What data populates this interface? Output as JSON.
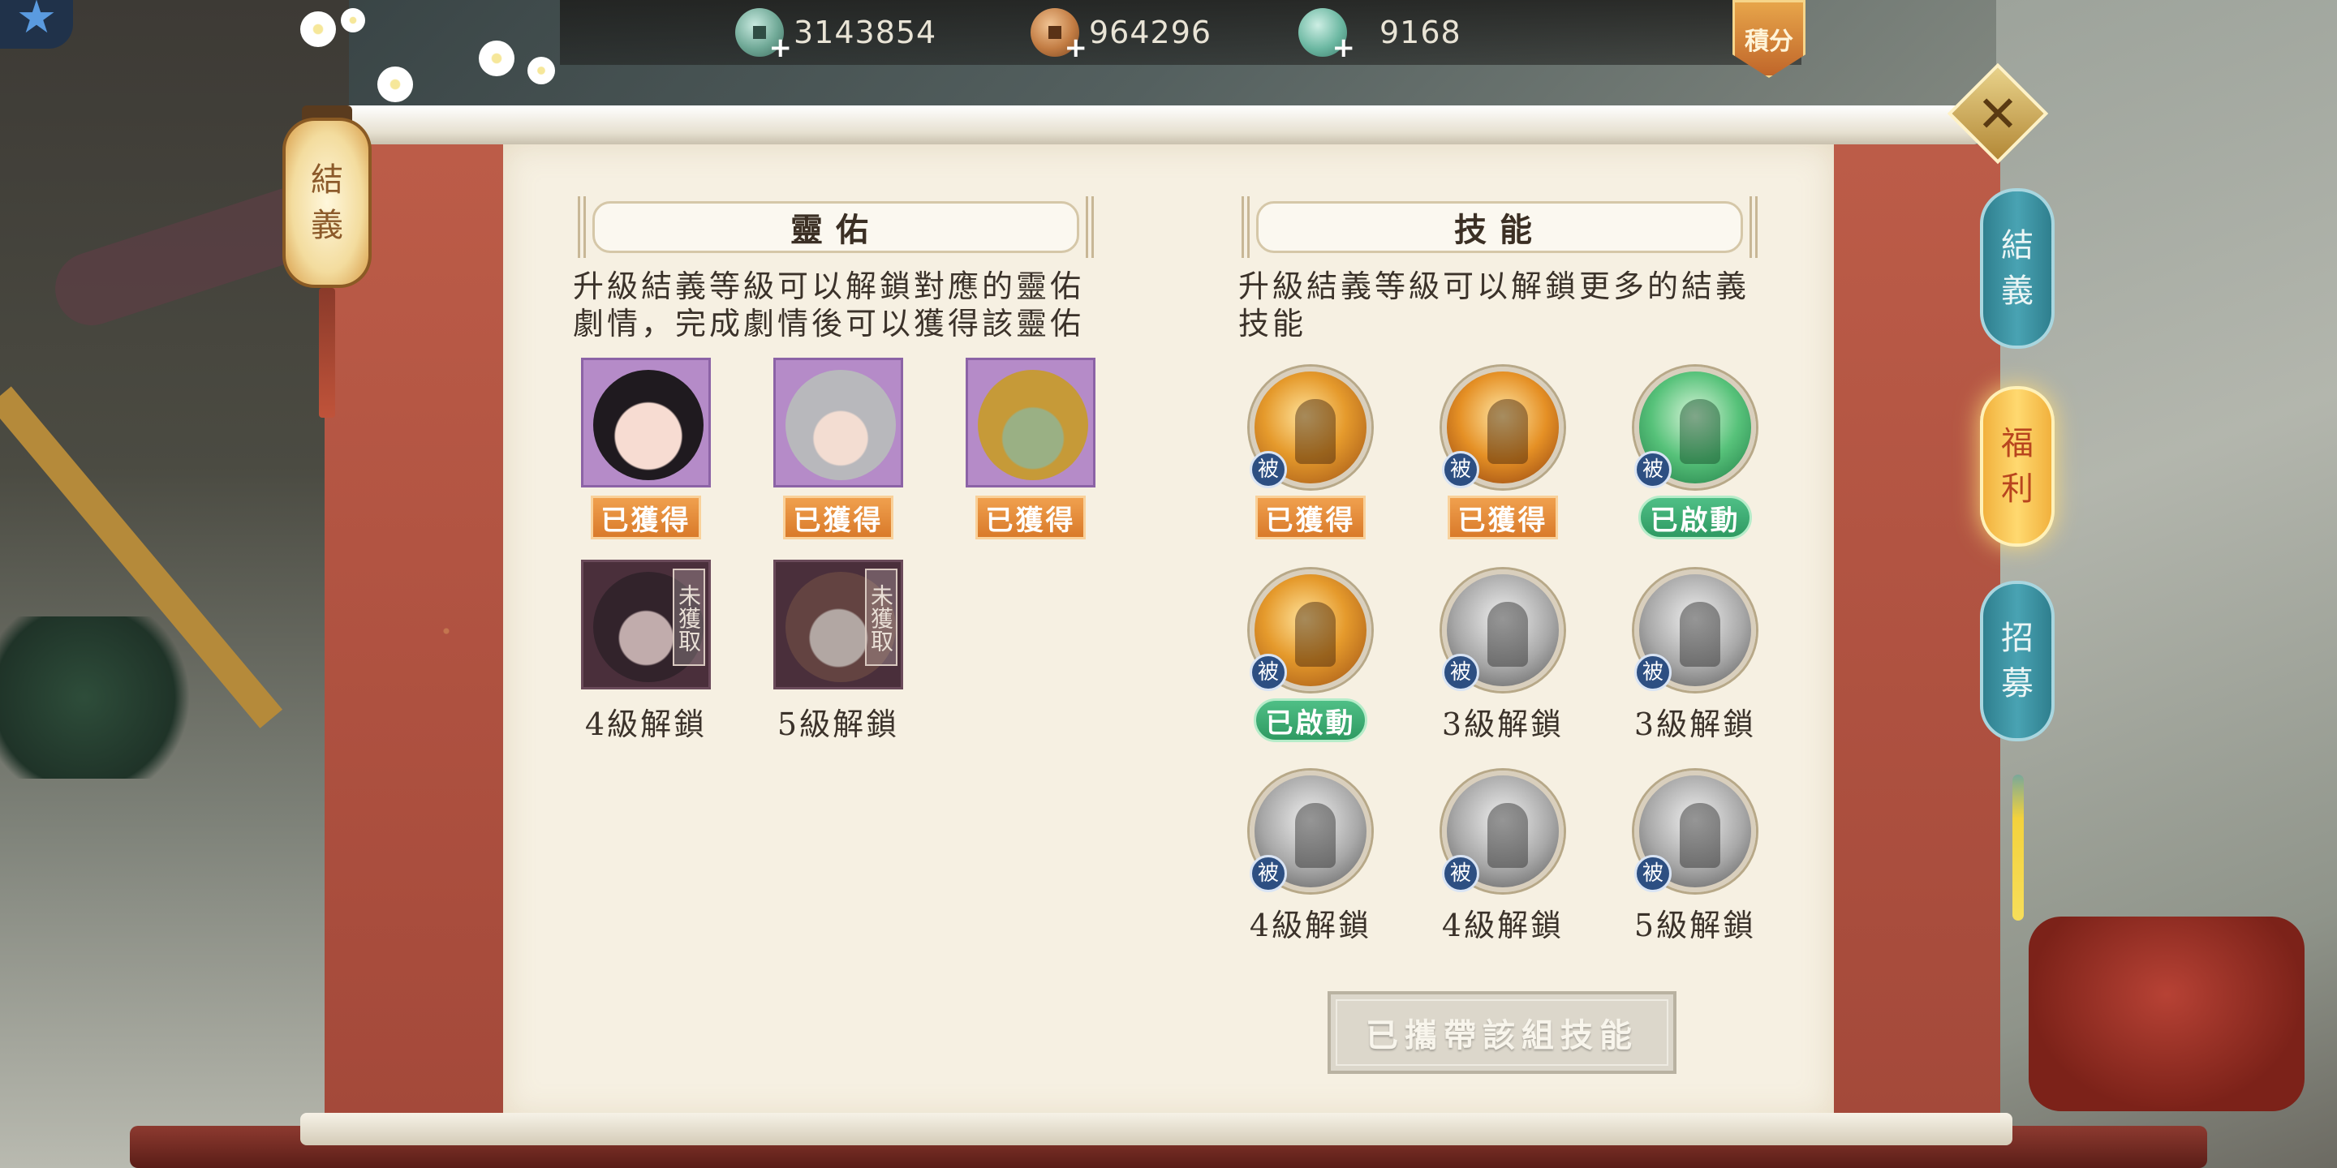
{
  "currencies": [
    {
      "icon": "jade-coin-icon",
      "value": "3143854"
    },
    {
      "icon": "copper-coin-icon",
      "value": "964296"
    },
    {
      "icon": "dragon-coin-icon",
      "value": "9168"
    }
  ],
  "points_badge": "積分",
  "lantern_label": [
    "結",
    "義"
  ],
  "spirit_section": {
    "title": "靈佑",
    "desc_lines": [
      "升級結義等級可以解鎖對應的靈佑",
      "劇情，完成劇情後可以獲得該靈佑"
    ],
    "items": [
      {
        "status": "已獲得"
      },
      {
        "status": "已獲得"
      },
      {
        "status": "已獲得"
      },
      {
        "lock_label": "未獲取",
        "status": "4級解鎖"
      },
      {
        "lock_label": "未獲取",
        "status": "5級解鎖"
      }
    ]
  },
  "skill_section": {
    "title": "技能",
    "desc_lines": [
      "升級結義等級可以解鎖更多的結義",
      "技能"
    ],
    "passive_label": "被",
    "items": [
      {
        "status": "已獲得"
      },
      {
        "status": "已獲得"
      },
      {
        "status": "已啟動"
      },
      {
        "status": "已啟動"
      },
      {
        "status": "3級解鎖"
      },
      {
        "status": "3級解鎖"
      },
      {
        "status": "4級解鎖"
      },
      {
        "status": "4級解鎖"
      },
      {
        "status": "5級解鎖"
      }
    ]
  },
  "carry_button": "已攜帶該組技能",
  "side_tabs": [
    {
      "label": [
        "結",
        "義"
      ],
      "active": false
    },
    {
      "label": [
        "福",
        "利"
      ],
      "active": true
    },
    {
      "label": [
        "招",
        "募"
      ],
      "active": false
    }
  ],
  "colors": {
    "panel_red": "#bc5c48",
    "paper": "#f6f0e2",
    "obtained_orange": "#e28a36",
    "activated_green": "#3aa86f",
    "active_tab_gold": "#ffd970",
    "tab_teal": "#3f95a5"
  }
}
